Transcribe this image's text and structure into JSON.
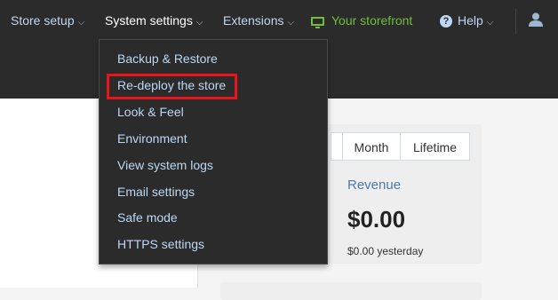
{
  "nav": {
    "store_setup": "Store setup",
    "system_settings": "System settings",
    "extensions": "Extensions",
    "storefront": "Your storefront",
    "help": "Help",
    "caret": "⌵"
  },
  "colors": {
    "topbar": "#2b2b2b",
    "link": "#bcd8f4",
    "storefront": "#6fbf3a",
    "highlight": "#e8141a",
    "revenue_label": "#4a7aa8"
  },
  "system_settings_menu": {
    "items": [
      "Backup & Restore",
      "Re-deploy the store",
      "Look & Feel",
      "Environment",
      "View system logs",
      "Email settings",
      "Safe mode",
      "HTTPS settings"
    ],
    "highlighted_index": 1
  },
  "dashboard": {
    "tabs": [
      "Month",
      "Lifetime"
    ],
    "revenue_label": "Revenue",
    "revenue_value": "$0.00",
    "revenue_yesterday": "$0.00 yesterday"
  },
  "icons": {
    "storefront": "monitor-icon",
    "help": "question-circle-icon",
    "user": "user-icon"
  }
}
